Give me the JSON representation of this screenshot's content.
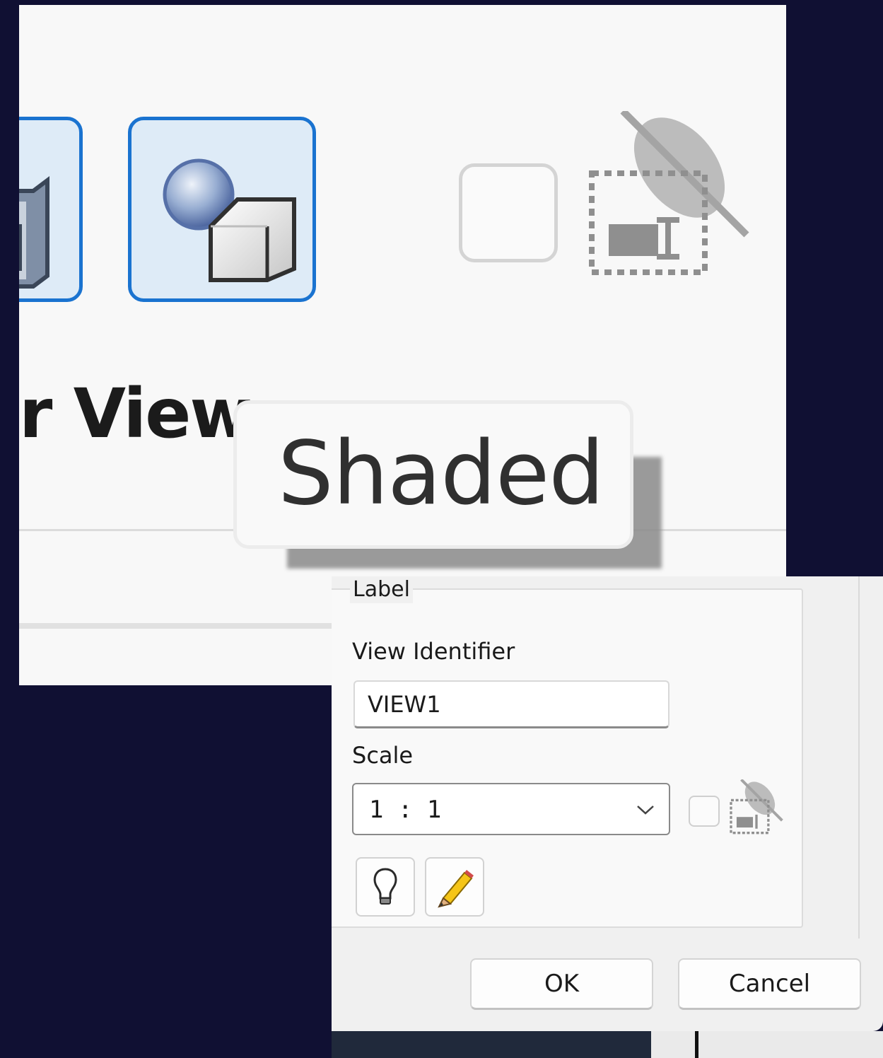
{
  "zoomed": {
    "partial_label": "r View",
    "tooltip": "Shaded",
    "style_buttons": [
      {
        "icon": "hidden-lines-style-icon",
        "state": "selected"
      },
      {
        "icon": "shaded-style-icon",
        "state": "selected"
      }
    ]
  },
  "dialog": {
    "group_label": "Label",
    "view_identifier_label": "View Identifier",
    "view_identifier_value": "VIEW1",
    "scale_label": "Scale",
    "scale_value": "1 : 1",
    "ok_label": "OK",
    "cancel_label": "Cancel"
  },
  "colors": {
    "accent": "#1a73d0",
    "selected_fill": "#deebf7",
    "background": "#101033"
  }
}
